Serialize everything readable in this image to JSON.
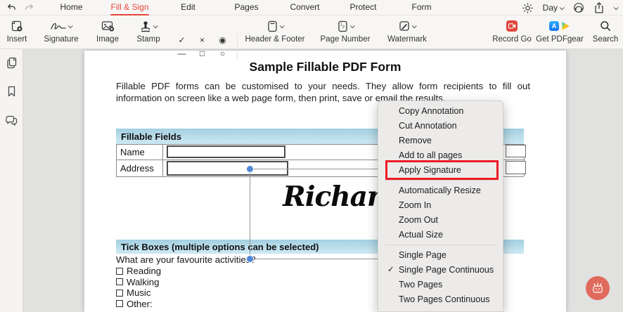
{
  "app": {
    "tabs": [
      {
        "label": "Home"
      },
      {
        "label": "Fill & Sign"
      },
      {
        "label": "Edit"
      },
      {
        "label": "Pages"
      },
      {
        "label": "Convert"
      },
      {
        "label": "Protect"
      },
      {
        "label": "Form"
      }
    ],
    "theme_label": "Day"
  },
  "toolbar": {
    "insert": "Insert",
    "signature": "Signature",
    "image": "Image",
    "stamp": "Stamp",
    "header_footer": "Header & Footer",
    "page_number": "Page Number",
    "watermark": "Watermark",
    "record_go": "Record Go",
    "get_pdfgear": "Get PDFgear",
    "search": "Search"
  },
  "icons": {
    "check": "✓",
    "cross": "×",
    "radio_filled": "◉",
    "dash": "—",
    "square": "□",
    "circle": "○",
    "appstore_letter": "A"
  },
  "document": {
    "title": "Sample Fillable PDF Form",
    "intro_line1": "Fillable PDF forms can be customised to your needs. They allow form recipients to fill out",
    "intro_line2": "information on screen like a web page form, then print, save or email the results.",
    "fillable_heading": "Fillable Fields",
    "field_rows": [
      {
        "label": "Name"
      },
      {
        "label": "Address"
      }
    ],
    "partial_text": "?",
    "signature": "Richard",
    "tick_heading": "Tick Boxes (multiple options can be selected)",
    "tick_question": "What are your favourite activities?",
    "tick_options": [
      {
        "label": "Reading"
      },
      {
        "label": "Walking"
      },
      {
        "label": "Music"
      },
      {
        "label": "Other:"
      }
    ]
  },
  "context_menu": {
    "items": [
      {
        "label": "Copy Annotation"
      },
      {
        "label": "Cut Annotation"
      },
      {
        "label": "Remove"
      },
      {
        "label": "Add to all pages"
      },
      {
        "label": "Apply Signature",
        "highlighted": true
      },
      {
        "label": "Automatically Resize"
      },
      {
        "label": "Zoom In"
      },
      {
        "label": "Zoom Out"
      },
      {
        "label": "Actual Size"
      },
      {
        "label": "Single Page"
      },
      {
        "label": "Single Page Continuous",
        "checked": true
      },
      {
        "label": "Two Pages"
      },
      {
        "label": "Two Pages Continuous"
      }
    ]
  },
  "colors": {
    "accent_red": "#e8463b",
    "highlight_red": "#ed1c24",
    "selection_blue": "#4d87d7",
    "section_blue_top": "#a3cfe0",
    "section_blue_bottom": "#c9e6f2",
    "record_red": "#e2473c",
    "robot_coral": "#e06a5b"
  }
}
